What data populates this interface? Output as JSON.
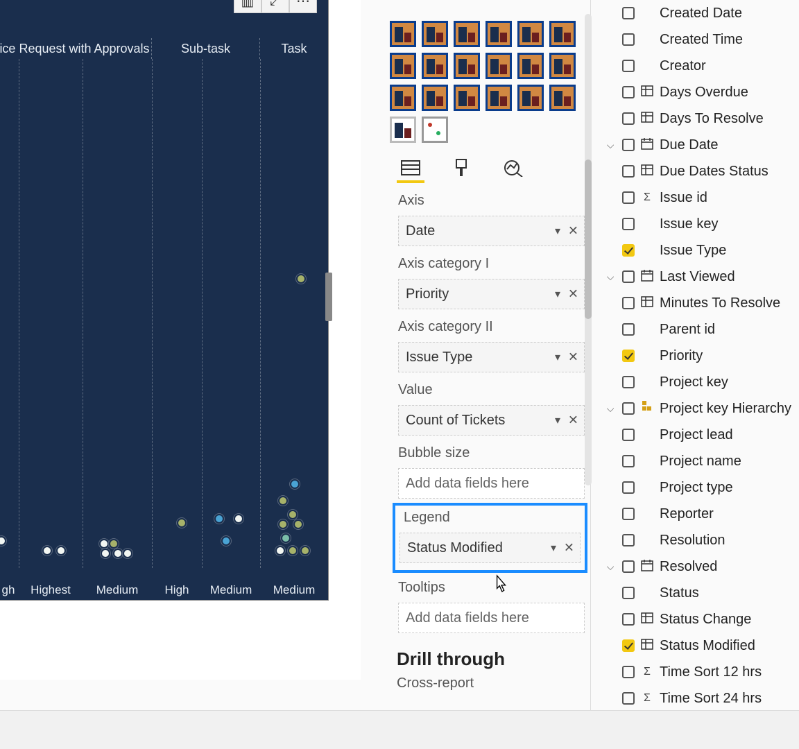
{
  "chart": {
    "columns": [
      "ice Request with Approvals",
      "Sub-task",
      "Task"
    ],
    "bottom_labels": [
      "gh",
      "Highest",
      "Medium",
      "High",
      "Medium",
      "Medium"
    ]
  },
  "viz": {
    "wells": {
      "axis": {
        "label": "Axis",
        "value": "Date"
      },
      "cat1": {
        "label": "Axis category I",
        "value": "Priority"
      },
      "cat2": {
        "label": "Axis category II",
        "value": "Issue Type"
      },
      "value": {
        "label": "Value",
        "value": "Count of Tickets"
      },
      "bubble": {
        "label": "Bubble size",
        "placeholder": "Add data fields here"
      },
      "legend": {
        "label": "Legend",
        "value": "Status Modified"
      },
      "tooltips": {
        "label": "Tooltips",
        "placeholder": "Add data fields here"
      }
    },
    "drill_heading": "Drill through",
    "cross_report": "Cross-report"
  },
  "fields": [
    {
      "label": "Created Date",
      "checked": false,
      "icon": ""
    },
    {
      "label": "Created Time",
      "checked": false,
      "icon": ""
    },
    {
      "label": "Creator",
      "checked": false,
      "icon": ""
    },
    {
      "label": "Days Overdue",
      "checked": false,
      "icon": "table"
    },
    {
      "label": "Days To Resolve",
      "checked": false,
      "icon": "table"
    },
    {
      "label": "Due Date",
      "checked": false,
      "icon": "cal",
      "expand": true
    },
    {
      "label": "Due Dates Status",
      "checked": false,
      "icon": "table"
    },
    {
      "label": "Issue id",
      "checked": false,
      "icon": "sigma"
    },
    {
      "label": "Issue key",
      "checked": false,
      "icon": ""
    },
    {
      "label": "Issue Type",
      "checked": true,
      "icon": ""
    },
    {
      "label": "Last Viewed",
      "checked": false,
      "icon": "cal",
      "expand": true
    },
    {
      "label": "Minutes To Resolve",
      "checked": false,
      "icon": "table"
    },
    {
      "label": "Parent id",
      "checked": false,
      "icon": ""
    },
    {
      "label": "Priority",
      "checked": true,
      "icon": ""
    },
    {
      "label": "Project key",
      "checked": false,
      "icon": ""
    },
    {
      "label": "Project key Hierarchy",
      "checked": false,
      "icon": "hier",
      "expand": true
    },
    {
      "label": "Project lead",
      "checked": false,
      "icon": ""
    },
    {
      "label": "Project name",
      "checked": false,
      "icon": ""
    },
    {
      "label": "Project type",
      "checked": false,
      "icon": ""
    },
    {
      "label": "Reporter",
      "checked": false,
      "icon": ""
    },
    {
      "label": "Resolution",
      "checked": false,
      "icon": ""
    },
    {
      "label": "Resolved",
      "checked": false,
      "icon": "cal",
      "expand": true
    },
    {
      "label": "Status",
      "checked": false,
      "icon": ""
    },
    {
      "label": "Status Change",
      "checked": false,
      "icon": "table"
    },
    {
      "label": "Status Modified",
      "checked": true,
      "icon": "table"
    },
    {
      "label": "Time Sort 12 hrs",
      "checked": false,
      "icon": "sigma"
    },
    {
      "label": "Time Sort 24 hrs",
      "checked": false,
      "icon": "sigma"
    }
  ],
  "chart_data": {
    "type": "scatter",
    "note": "Bubble positions estimated from pixels; no numeric axes visible.",
    "categories_level1": [
      "ice Request with Approvals",
      "Sub-task",
      "Task"
    ],
    "categories_level2": [
      "gh",
      "Highest",
      "Medium",
      "High",
      "Medium",
      "Medium"
    ],
    "points": [
      {
        "group": "Task",
        "sub": "Medium",
        "y_rel": 0.48,
        "series": "olive"
      },
      {
        "group": "Task",
        "sub": "Medium",
        "y_rel": 0.12,
        "series": "blue"
      },
      {
        "group": "Task",
        "sub": "Medium",
        "y_rel": 0.09,
        "series": "olive"
      },
      {
        "group": "Task",
        "sub": "Medium",
        "y_rel": 0.07,
        "series": "olive"
      },
      {
        "group": "Task",
        "sub": "Medium",
        "y_rel": 0.05,
        "series": "olive"
      },
      {
        "group": "Task",
        "sub": "Medium",
        "y_rel": 0.04,
        "series": "olive"
      },
      {
        "group": "Task",
        "sub": "Medium",
        "y_rel": 0.03,
        "series": "white"
      },
      {
        "group": "Sub-task",
        "sub": "High",
        "y_rel": 0.11,
        "series": "olive"
      },
      {
        "group": "Sub-task",
        "sub": "Medium",
        "y_rel": 0.065,
        "series": "blue"
      },
      {
        "group": "Sub-task",
        "sub": "Medium",
        "y_rel": 0.065,
        "series": "white"
      },
      {
        "group": "Sub-task",
        "sub": "Medium",
        "y_rel": 0.03,
        "series": "blue"
      },
      {
        "group": "ice Request with Approvals",
        "sub": "Medium",
        "y_rel": 0.045,
        "series": "white"
      },
      {
        "group": "ice Request with Approvals",
        "sub": "Medium",
        "y_rel": 0.03,
        "series": "olive"
      },
      {
        "group": "ice Request with Approvals",
        "sub": "Medium",
        "y_rel": 0.03,
        "series": "white"
      },
      {
        "group": "ice Request with Approvals",
        "sub": "Highest",
        "y_rel": 0.025,
        "series": "white"
      },
      {
        "group": "ice Request with Approvals",
        "sub": "Highest",
        "y_rel": 0.025,
        "series": "white"
      },
      {
        "group": "ice Request with Approvals",
        "sub": "gh",
        "y_rel": 0.04,
        "series": "white"
      }
    ]
  }
}
